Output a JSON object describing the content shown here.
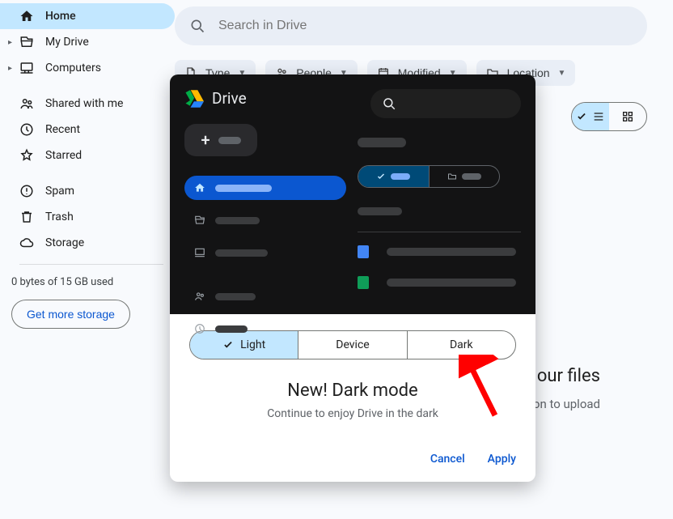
{
  "search": {
    "placeholder": "Search in Drive"
  },
  "sidebar": {
    "items": [
      {
        "label": "Home"
      },
      {
        "label": "My Drive"
      },
      {
        "label": "Computers"
      },
      {
        "label": "Shared with me"
      },
      {
        "label": "Recent"
      },
      {
        "label": "Starred"
      },
      {
        "label": "Spam"
      },
      {
        "label": "Trash"
      },
      {
        "label": "Storage"
      }
    ],
    "quota": "0 bytes of 15 GB used",
    "storage_cta": "Get more storage"
  },
  "chips": {
    "type": "Type",
    "people": "People",
    "modified": "Modified",
    "location": "Location"
  },
  "empty": {
    "title_right": "our files",
    "subtitle_right": "on to upload"
  },
  "dialog": {
    "brand": "Drive",
    "segments": {
      "light": "Light",
      "device": "Device",
      "dark": "Dark"
    },
    "title": "New! Dark mode",
    "subtitle": "Continue to enjoy Drive in the dark",
    "actions": {
      "cancel": "Cancel",
      "apply": "Apply"
    }
  }
}
